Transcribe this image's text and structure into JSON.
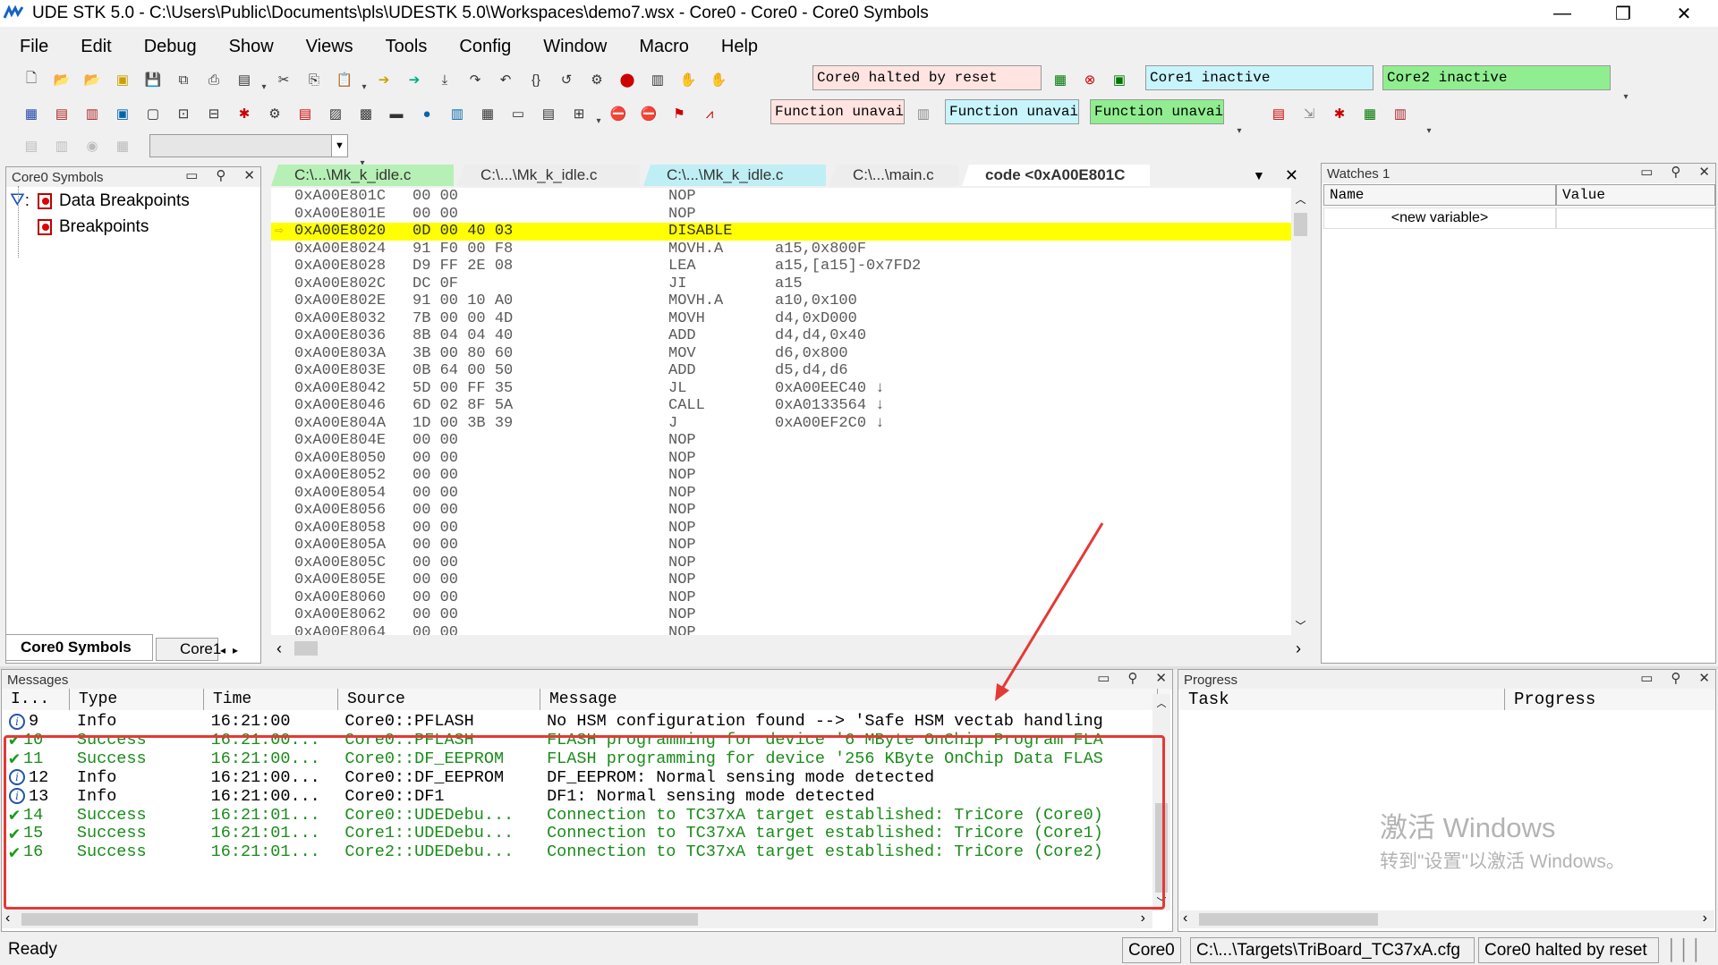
{
  "window": {
    "title": "UDE STK 5.0 - C:\\Users\\Public\\Documents\\pls\\UDESTK 5.0\\Workspaces\\demo7.wsx - Core0 - Core0 - Core0 Symbols",
    "minimize": "—",
    "restore": "❐",
    "close": "✕"
  },
  "menu": [
    "File",
    "Edit",
    "Debug",
    "Show",
    "Views",
    "Tools",
    "Config",
    "Window",
    "Macro",
    "Help"
  ],
  "toolbar": {
    "core0_status": "Core0 halted by reset",
    "core1_status": "Core1 inactive",
    "core2_status": "Core2 inactive",
    "func1": "Function unavai.",
    "func2": "Function unavai.",
    "func3": "Function unavai."
  },
  "colors": {
    "core0_status_bg": "#ffe4e1",
    "core1_status_bg": "#c8f4fc",
    "core2_status_bg": "#90ee90",
    "func1_bg": "#ffe4e1",
    "func2_bg": "#c8f4fc",
    "func3_bg": "#90ee90",
    "highlight": "#ffff00",
    "success_text": "#1a8c1a",
    "annotation": "#e53935"
  },
  "symbols_panel": {
    "title": "Core0 Symbols",
    "filter_label": ":",
    "items": [
      "Data Breakpoints",
      "Breakpoints"
    ],
    "tabs": [
      "Core0 Symbols",
      "Core1"
    ]
  },
  "editor": {
    "tabs": [
      "C:\\...\\Mk_k_idle.c",
      "C:\\...\\Mk_k_idle.c",
      "C:\\...\\Mk_k_idle.c",
      "C:\\...\\main.c",
      "code <0xA00E801C"
    ],
    "lines": [
      {
        "addr": "0xA00E801C",
        "bytes": "00 00",
        "mn": "NOP",
        "ops": ""
      },
      {
        "addr": "0xA00E801E",
        "bytes": "00 00",
        "mn": "NOP",
        "ops": ""
      },
      {
        "addr": "0xA00E8020",
        "bytes": "0D 00 40 03",
        "mn": "DISABLE",
        "ops": ""
      },
      {
        "addr": "0xA00E8024",
        "bytes": "91 F0 00 F8",
        "mn": "MOVH.A",
        "ops": "a15,0x800F"
      },
      {
        "addr": "0xA00E8028",
        "bytes": "D9 FF 2E 08",
        "mn": "LEA",
        "ops": "a15,[a15]-0x7FD2"
      },
      {
        "addr": "0xA00E802C",
        "bytes": "DC 0F",
        "mn": "JI",
        "ops": "a15"
      },
      {
        "addr": "0xA00E802E",
        "bytes": "91 00 10 A0",
        "mn": "MOVH.A",
        "ops": "a10,0x100"
      },
      {
        "addr": "0xA00E8032",
        "bytes": "7B 00 00 4D",
        "mn": "MOVH",
        "ops": "d4,0xD000"
      },
      {
        "addr": "0xA00E8036",
        "bytes": "8B 04 04 40",
        "mn": "ADD",
        "ops": "d4,d4,0x40"
      },
      {
        "addr": "0xA00E803A",
        "bytes": "3B 00 80 60",
        "mn": "MOV",
        "ops": "d6,0x800"
      },
      {
        "addr": "0xA00E803E",
        "bytes": "0B 64 00 50",
        "mn": "ADD",
        "ops": "d5,d4,d6"
      },
      {
        "addr": "0xA00E8042",
        "bytes": "5D 00 FF 35",
        "mn": "JL",
        "ops": "0xA00EEC40 ↓"
      },
      {
        "addr": "0xA00E8046",
        "bytes": "6D 02 8F 5A",
        "mn": "CALL",
        "ops": "0xA0133564 ↓"
      },
      {
        "addr": "0xA00E804A",
        "bytes": "1D 00 3B 39",
        "mn": "J",
        "ops": "0xA00EF2C0 ↓"
      },
      {
        "addr": "0xA00E804E",
        "bytes": "00 00",
        "mn": "NOP",
        "ops": ""
      },
      {
        "addr": "0xA00E8050",
        "bytes": "00 00",
        "mn": "NOP",
        "ops": ""
      },
      {
        "addr": "0xA00E8052",
        "bytes": "00 00",
        "mn": "NOP",
        "ops": ""
      },
      {
        "addr": "0xA00E8054",
        "bytes": "00 00",
        "mn": "NOP",
        "ops": ""
      },
      {
        "addr": "0xA00E8056",
        "bytes": "00 00",
        "mn": "NOP",
        "ops": ""
      },
      {
        "addr": "0xA00E8058",
        "bytes": "00 00",
        "mn": "NOP",
        "ops": ""
      },
      {
        "addr": "0xA00E805A",
        "bytes": "00 00",
        "mn": "NOP",
        "ops": ""
      },
      {
        "addr": "0xA00E805C",
        "bytes": "00 00",
        "mn": "NOP",
        "ops": ""
      },
      {
        "addr": "0xA00E805E",
        "bytes": "00 00",
        "mn": "NOP",
        "ops": ""
      },
      {
        "addr": "0xA00E8060",
        "bytes": "00 00",
        "mn": "NOP",
        "ops": ""
      },
      {
        "addr": "0xA00E8062",
        "bytes": "00 00",
        "mn": "NOP",
        "ops": ""
      },
      {
        "addr": "0xA00E8064",
        "bytes": "00 00",
        "mn": "NOP",
        "ops": ""
      }
    ]
  },
  "watches": {
    "title": "Watches 1",
    "columns": [
      "Name",
      "Value"
    ],
    "new_variable": "<new variable>"
  },
  "messages": {
    "title": "Messages",
    "columns": [
      "I...",
      "Type",
      "Time",
      "Source",
      "Message"
    ],
    "rows": [
      {
        "id": "9",
        "type": "Info",
        "time": "16:21:00",
        "source": "Core0::PFLASH",
        "message": "No HSM configuration found --> 'Safe HSM vectab handling",
        "kind": "info"
      },
      {
        "id": "10",
        "type": "Success",
        "time": "16:21:00...",
        "source": "Core0::PFLASH",
        "message": "FLASH programming for device '6 MByte OnChip Program FLA",
        "kind": "success"
      },
      {
        "id": "11",
        "type": "Success",
        "time": "16:21:00...",
        "source": "Core0::DF_EEPROM",
        "message": "FLASH programming for device '256 KByte OnChip Data FLAS",
        "kind": "success"
      },
      {
        "id": "12",
        "type": "Info",
        "time": "16:21:00...",
        "source": "Core0::DF_EEPROM",
        "message": "DF_EEPROM: Normal sensing mode detected",
        "kind": "info"
      },
      {
        "id": "13",
        "type": "Info",
        "time": "16:21:00...",
        "source": "Core0::DF1",
        "message": "DF1: Normal sensing mode detected",
        "kind": "info"
      },
      {
        "id": "14",
        "type": "Success",
        "time": "16:21:01...",
        "source": "Core0::UDEDebu...",
        "message": "Connection to TC37xA target established: TriCore (Core0)",
        "kind": "success"
      },
      {
        "id": "15",
        "type": "Success",
        "time": "16:21:01...",
        "source": "Core1::UDEDebu...",
        "message": "Connection to TC37xA target established: TriCore (Core1)",
        "kind": "success"
      },
      {
        "id": "16",
        "type": "Success",
        "time": "16:21:01...",
        "source": "Core2::UDEDebu...",
        "message": "Connection to TC37xA target established: TriCore (Core2)",
        "kind": "success"
      }
    ]
  },
  "progress": {
    "title": "Progress",
    "columns": [
      "Task",
      "Progress"
    ]
  },
  "watermark": {
    "line1": "激活 Windows",
    "line2": "转到\"设置\"以激活 Windows。"
  },
  "statusbar": {
    "ready": "Ready",
    "core": "Core0",
    "config": "C:\\...\\Targets\\TriBoard_TC37xA.cfg",
    "state": "Core0 halted by reset"
  }
}
